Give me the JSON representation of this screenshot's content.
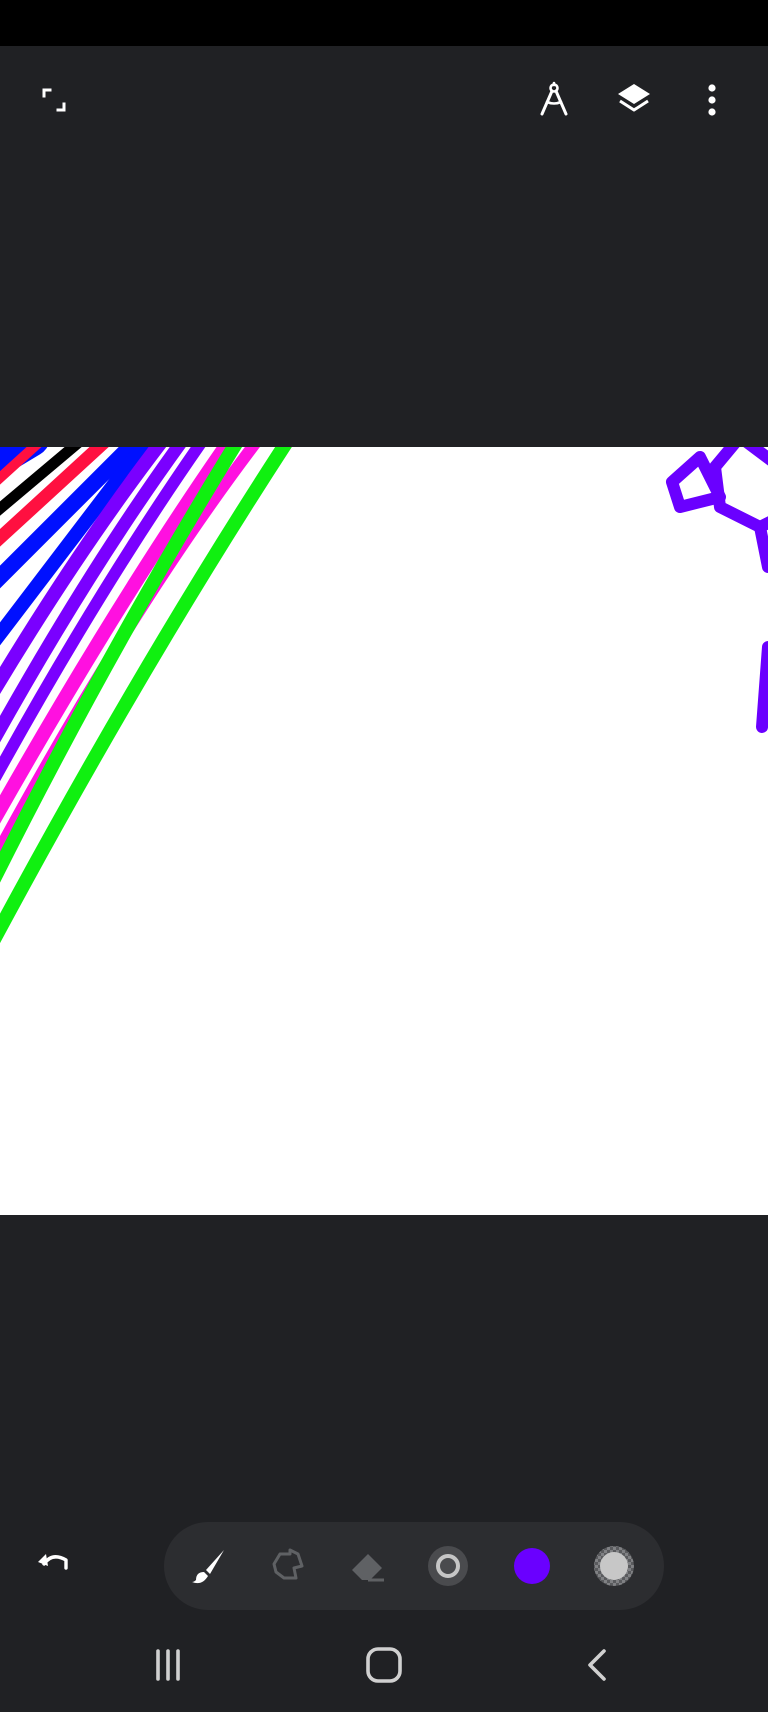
{
  "app": {
    "colors": {
      "background": "#202124",
      "toolbar_bg": "#2c2d30",
      "icon": "#ffffff",
      "icon_disabled": "#5f6164",
      "active_color": "#6a00ff"
    }
  },
  "top_bar": {
    "icons": [
      "fullscreen-icon",
      "compass-ruler-icon",
      "layers-icon",
      "more-vert-icon"
    ]
  },
  "bottom_toolbar": {
    "undo_icon": "undo-icon",
    "tools": [
      {
        "name": "brush",
        "icon": "brush-icon",
        "enabled": true
      },
      {
        "name": "smudge",
        "icon": "smudge-icon",
        "enabled": false
      },
      {
        "name": "eraser",
        "icon": "eraser-icon",
        "enabled": false
      },
      {
        "name": "brush-size",
        "icon": "brush-size-icon",
        "enabled": true
      },
      {
        "name": "color",
        "icon": "color-swatch-icon",
        "color": "#6a00ff"
      },
      {
        "name": "opacity",
        "icon": "opacity-icon",
        "enabled": true
      }
    ]
  },
  "nav_bar": {
    "icons": [
      "recent-apps-icon",
      "home-icon",
      "back-icon"
    ]
  }
}
